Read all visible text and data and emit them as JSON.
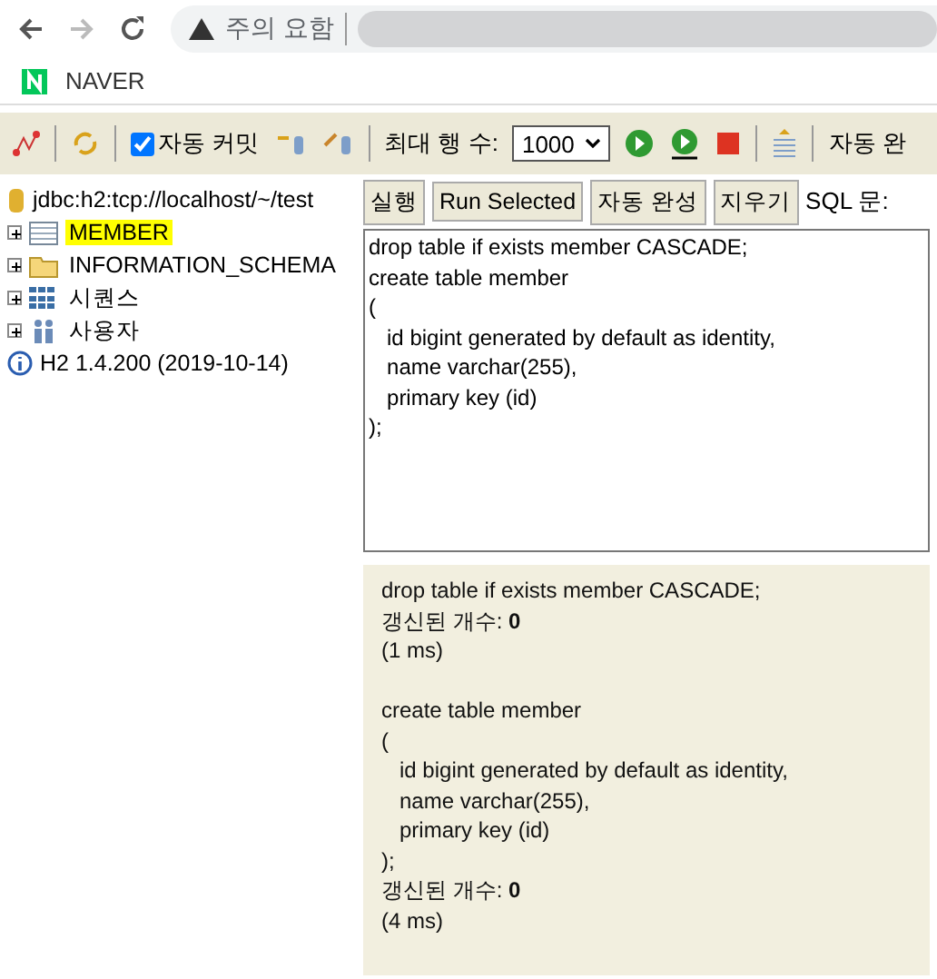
{
  "browser": {
    "security_label": "주의 요함",
    "bookmarks": [
      {
        "label": "NAVER"
      }
    ]
  },
  "toolbar": {
    "auto_commit": {
      "label": "자동 커밋",
      "checked": true
    },
    "max_rows_label": "최대 행 수:",
    "max_rows_value": "1000",
    "auto_complete_label": "자동 완"
  },
  "tree": {
    "connection": "jdbc:h2:tcp://localhost/~/test",
    "items": [
      {
        "kind": "table",
        "label": "MEMBER",
        "selected": true
      },
      {
        "kind": "folder",
        "label": "INFORMATION_SCHEMA",
        "selected": false
      },
      {
        "kind": "sequence",
        "label": "시퀀스",
        "selected": false
      },
      {
        "kind": "users",
        "label": "사용자",
        "selected": false
      }
    ],
    "version": "H2 1.4.200 (2019-10-14)"
  },
  "sql": {
    "buttons": [
      "실행",
      "Run Selected",
      "자동 완성",
      "지우기"
    ],
    "label": "SQL 문:",
    "text": "drop table if exists member CASCADE;\ncreate table member\n(\n   id bigint generated by default as identity,\n   name varchar(255),\n   primary key (id)\n);"
  },
  "result": {
    "blocks": [
      [
        "drop table if exists member CASCADE;",
        "갱신된 개수: **0**",
        "(1 ms)"
      ],
      [
        "create table member",
        "(",
        "   id bigint generated by default as identity,",
        "   name varchar(255),",
        "   primary key (id)",
        ");",
        "갱신된 개수: **0**",
        "(4 ms)"
      ]
    ]
  }
}
